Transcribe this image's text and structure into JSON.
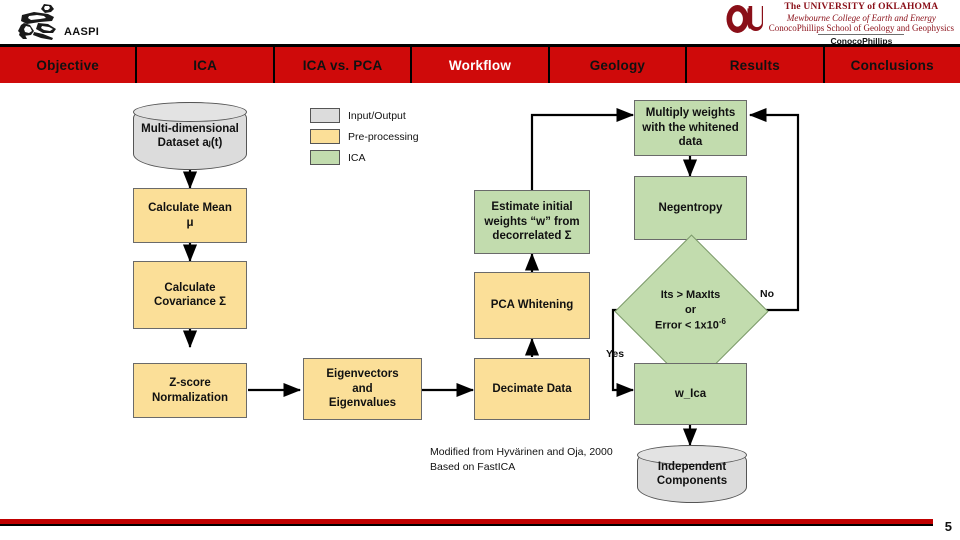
{
  "header": {
    "aaspi_label": "AASPI",
    "aaspi_logo_icon": "aaspi-figure-logo",
    "ou_mark_icon": "ou-monogram-icon",
    "university_line1": "The UNIVERSITY of OKLAHOMA",
    "university_line2": "Mewbourne College of Earth and Energy",
    "university_line3": "ConocoPhillips School of Geology and Geophysics",
    "sponsor": "ConocoPhillips"
  },
  "nav": {
    "items": [
      {
        "label": "Objective",
        "active": false
      },
      {
        "label": "ICA",
        "active": false
      },
      {
        "label": "ICA vs. PCA",
        "active": false
      },
      {
        "label": "Workflow",
        "active": true
      },
      {
        "label": "Geology",
        "active": false
      },
      {
        "label": "Results",
        "active": false
      },
      {
        "label": "Conclusions",
        "active": false
      }
    ]
  },
  "legend": {
    "items": [
      {
        "label": "Input/Output",
        "color": "#dcdcdc"
      },
      {
        "label": "Pre-processing",
        "color": "#fbdf98"
      },
      {
        "label": "ICA",
        "color": "#c2dcae"
      }
    ]
  },
  "flowchart": {
    "nodes": [
      {
        "id": "dataset",
        "text": "Multi-dimensional\nDataset aⱼ(t)",
        "type": "io"
      },
      {
        "id": "mean",
        "text": "Calculate Mean\nμ",
        "type": "pre"
      },
      {
        "id": "cov",
        "text": "Calculate\nCovariance Σ",
        "type": "pre"
      },
      {
        "id": "zscore",
        "text": "Z-score\nNormalization",
        "type": "pre"
      },
      {
        "id": "eigen",
        "text": "Eigenvectors\nand\nEigenvalues",
        "type": "pre"
      },
      {
        "id": "decimate",
        "text": "Decimate Data",
        "type": "pre"
      },
      {
        "id": "whiten",
        "text": "PCA Whitening",
        "type": "pre"
      },
      {
        "id": "initw",
        "text": "Estimate initial\nweights “w” from\ndecorrelated Σ",
        "type": "ica"
      },
      {
        "id": "multiply",
        "text": "Multiply weights\nwith the whitened\ndata",
        "type": "ica"
      },
      {
        "id": "negentropy",
        "text": "Negentropy",
        "type": "ica"
      },
      {
        "id": "wica",
        "text": "w_Ica",
        "type": "ica"
      },
      {
        "id": "output",
        "text": "Independent\nComponents",
        "type": "io"
      }
    ],
    "decision": {
      "id": "decision",
      "line1": "Its > MaxIts",
      "line2": "or",
      "line3": "Error < 1x10",
      "exponent": "-6"
    },
    "edge_labels": {
      "yes": "Yes",
      "no": "No"
    },
    "credit_line1": "Modified from Hyvärinen and Oja, 2000",
    "credit_line2": "Based on FastICA"
  },
  "footer": {
    "page_number": "5"
  },
  "colors": {
    "nav_red": "#cf0a0a",
    "accent_red": "#c00000",
    "io_gray": "#dcdcdc",
    "pre_yellow": "#fbdf98",
    "ica_green": "#c2dcae",
    "ou_crimson": "#8a0f18"
  }
}
